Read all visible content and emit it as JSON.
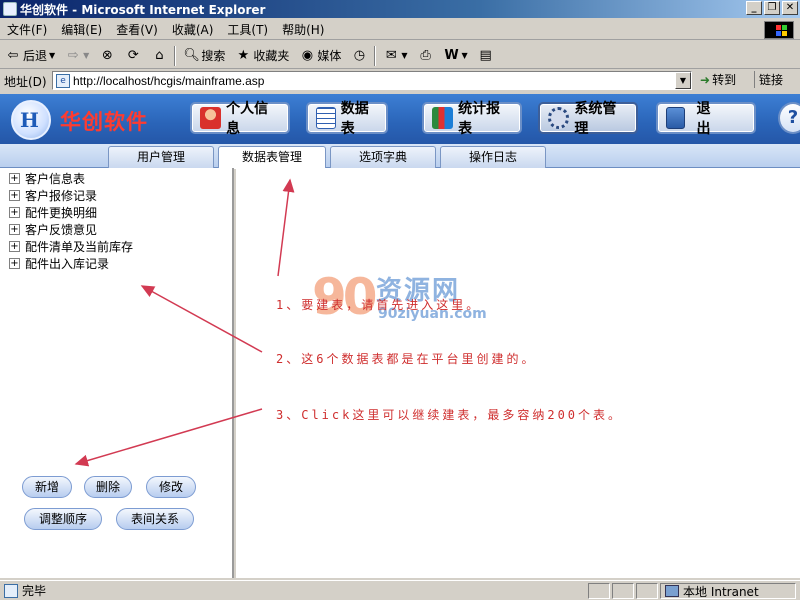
{
  "window": {
    "title": "华创软件 - Microsoft Internet Explorer"
  },
  "menu": [
    "文件(F)",
    "编辑(E)",
    "查看(V)",
    "收藏(A)",
    "工具(T)",
    "帮助(H)"
  ],
  "toolbar": {
    "back": "后退",
    "search": "搜索",
    "favorites": "收藏夹",
    "media": "媒体"
  },
  "address": {
    "label": "地址(D)",
    "url": "http://localhost/hcgis/mainframe.asp",
    "go": "转到",
    "links": "链接"
  },
  "app": {
    "logo_text": "华创软件",
    "nav": [
      "个人信息",
      "数据表",
      "统计报表",
      "系统管理",
      "退  出"
    ],
    "tabs": [
      "用户管理",
      "数据表管理",
      "选项字典",
      "操作日志"
    ],
    "active_tab": "数据表管理"
  },
  "tree": [
    "客户信息表",
    "客户报修记录",
    "配件更换明细",
    "客户反馈意见",
    "配件清单及当前库存",
    "配件出入库记录"
  ],
  "buttons": {
    "add": "新增",
    "delete": "删除",
    "edit": "修改",
    "reorder": "调整顺序",
    "relations": "表间关系"
  },
  "watermark": {
    "zh": "资源网",
    "en": "90ziyuan.com",
    "num": "90"
  },
  "notes": [
    "1、要建表，请首先进入这里。",
    "2、这6个数据表都是在平台里创建的。",
    "3、Click这里可以继续建表，最多容纳200个表。"
  ],
  "status": {
    "text": "完毕",
    "zone": "本地 Intranet"
  },
  "colors": {
    "accent": "#2a64b8",
    "note": "#cf2e2e",
    "logo": "#ff3b2f"
  }
}
